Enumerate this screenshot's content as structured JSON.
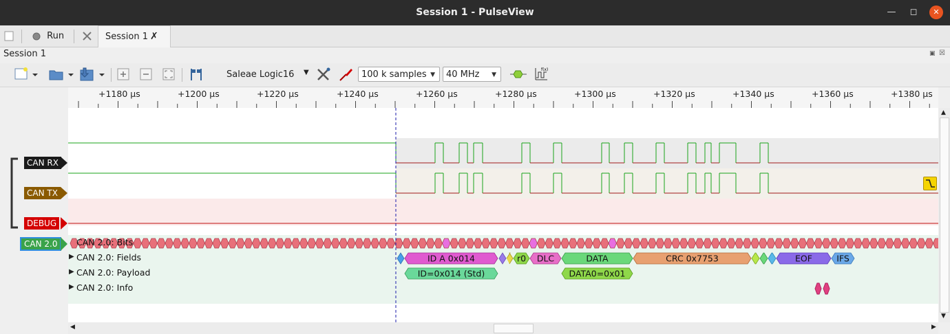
{
  "window": {
    "title": "Session 1 - PulseView"
  },
  "tabbar": {
    "run_label": "Run",
    "session_tab": "Session 1"
  },
  "dock": {
    "title": "Session 1"
  },
  "toolbar": {
    "device": "Saleae Logic16",
    "samples": "100 k samples",
    "samplerate": "40 MHz"
  },
  "ruler": {
    "ticks": [
      "+1180 µs",
      "+1200 µs",
      "+1220 µs",
      "+1240 µs",
      "+1260 µs",
      "+1280 µs",
      "+1300 µs",
      "+1320 µs",
      "+1340 µs",
      "+1360 µs",
      "+1380 µs"
    ]
  },
  "channels": {
    "rx": {
      "label": "CAN RX",
      "color": "#1a1a1a"
    },
    "tx": {
      "label": "CAN TX",
      "color": "#8a5a00"
    },
    "debug": {
      "label": "DEBUG",
      "color": "#d40000"
    },
    "decoder": {
      "label": "CAN 2.0",
      "color": "#3aa34a"
    }
  },
  "decoder_rows": {
    "bits": "CAN 2.0: Bits",
    "fields": "CAN 2.0: Fields",
    "payload": "CAN 2.0: Payload",
    "info": "CAN 2.0: Info"
  },
  "annotations": {
    "fields": [
      "ID A 0x014",
      "r0",
      "DLC",
      "DATA",
      "CRC 0x7753",
      "EOF",
      "IFS"
    ],
    "payload": [
      "ID=0x014 (Std)",
      "DATA0=0x01"
    ]
  },
  "colors": {
    "signal_high": "#1aa31a",
    "signal_low": "#a01818",
    "cursor": "#1a1aaa",
    "bit_fill": "#e8707a"
  }
}
